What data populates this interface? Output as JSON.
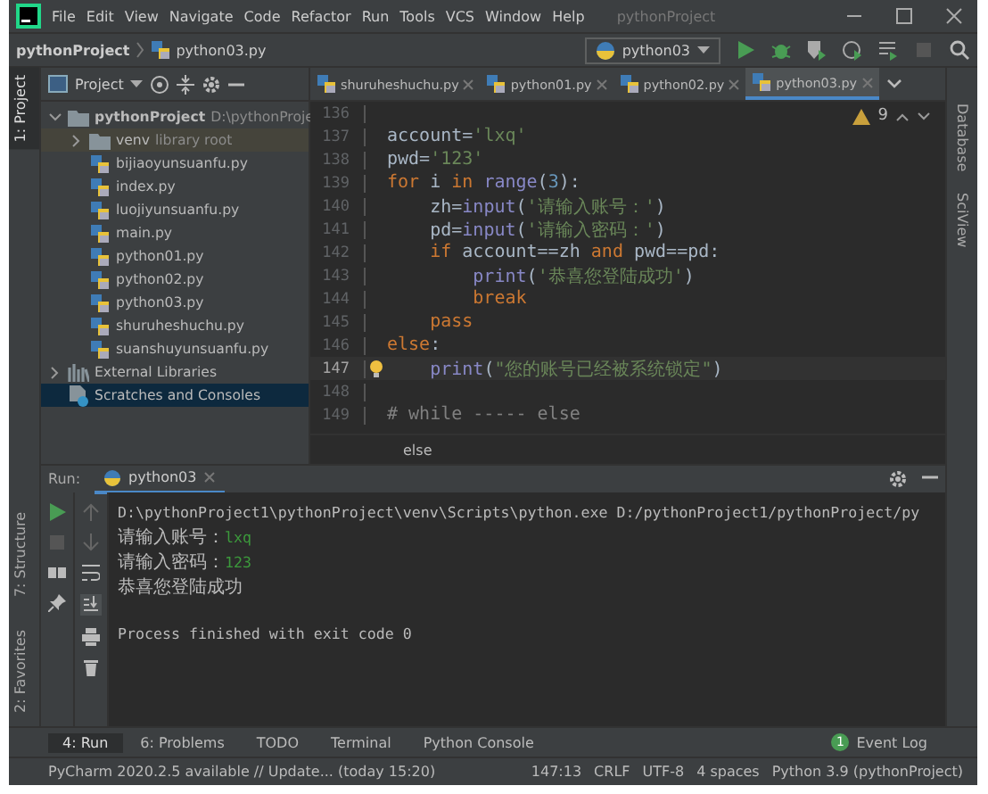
{
  "window": {
    "title": "pythonProject",
    "menu": [
      "File",
      "Edit",
      "View",
      "Navigate",
      "Code",
      "Refactor",
      "Run",
      "Tools",
      "VCS",
      "Window",
      "Help"
    ]
  },
  "navbar": {
    "breadcrumb": [
      "pythonProject",
      "python03.py"
    ],
    "run_config": "python03"
  },
  "left_stripe": {
    "top": [
      {
        "label": "1: Project",
        "selected": true
      }
    ],
    "bottom": [
      {
        "label": "7: Structure",
        "selected": false
      },
      {
        "label": "2: Favorites",
        "selected": false
      }
    ]
  },
  "right_stripe": [
    "Database",
    "SciView"
  ],
  "project_panel": {
    "title": "Project",
    "tree": [
      {
        "label": "pythonProject",
        "hint": "D:\\pythonProje",
        "kind": "folder",
        "expanded": true,
        "selected": false,
        "children": [
          {
            "label": "venv",
            "hint": "library root",
            "kind": "folder",
            "expanded": false,
            "selected": false
          },
          {
            "label": "bijiaoyunsuanfu.py",
            "kind": "file",
            "selected": false
          },
          {
            "label": "index.py",
            "kind": "file",
            "selected": false
          },
          {
            "label": "luojiyunsuanfu.py",
            "kind": "file",
            "selected": false
          },
          {
            "label": "main.py",
            "kind": "file",
            "selected": false
          },
          {
            "label": "python01.py",
            "kind": "file",
            "selected": false
          },
          {
            "label": "python02.py",
            "kind": "file",
            "selected": false
          },
          {
            "label": "python03.py",
            "kind": "file",
            "selected": false
          },
          {
            "label": "shuruheshuchu.py",
            "kind": "file",
            "selected": false
          },
          {
            "label": "suanshuyunsuanfu.py",
            "kind": "file",
            "selected": false
          }
        ]
      },
      {
        "label": "External Libraries",
        "kind": "libraries",
        "expanded": false,
        "selected": false
      },
      {
        "label": "Scratches and Consoles",
        "kind": "scratches",
        "selected": true
      }
    ]
  },
  "editor": {
    "tabs": [
      {
        "label": "shuruheshuchu.py",
        "selected": false
      },
      {
        "label": "python01.py",
        "selected": false
      },
      {
        "label": "python02.py",
        "selected": false
      },
      {
        "label": "python03.py",
        "selected": true
      }
    ],
    "warnings": "9",
    "lines": [
      {
        "number": "136",
        "current": false
      },
      {
        "number": "137",
        "current": false,
        "tokens": [
          {
            "kind": "plain",
            "text": "account="
          },
          {
            "kind": "string",
            "text": "'lxq'"
          }
        ]
      },
      {
        "number": "138",
        "current": false,
        "tokens": [
          {
            "kind": "plain",
            "text": "pwd="
          },
          {
            "kind": "string",
            "text": "'123'"
          }
        ]
      },
      {
        "number": "139",
        "current": false,
        "tokens": [
          {
            "kind": "keyword",
            "text": "for"
          },
          {
            "kind": "plain",
            "text": " i "
          },
          {
            "kind": "keyword",
            "text": "in"
          },
          {
            "kind": "builtin",
            "text": " range"
          },
          {
            "kind": "plain",
            "text": "("
          },
          {
            "kind": "number",
            "text": "3"
          },
          {
            "kind": "plain",
            "text": "):"
          }
        ]
      },
      {
        "number": "140",
        "current": false,
        "tokens": [
          {
            "kind": "plain",
            "text": "    zh="
          },
          {
            "kind": "builtin",
            "text": "input"
          },
          {
            "kind": "plain",
            "text": "("
          },
          {
            "kind": "string",
            "text": "'请输入账号：'"
          },
          {
            "kind": "plain",
            "text": ")"
          }
        ]
      },
      {
        "number": "141",
        "current": false,
        "tokens": [
          {
            "kind": "plain",
            "text": "    pd="
          },
          {
            "kind": "builtin",
            "text": "input"
          },
          {
            "kind": "plain",
            "text": "("
          },
          {
            "kind": "string",
            "text": "'请输入密码：'"
          },
          {
            "kind": "plain",
            "text": ")"
          }
        ]
      },
      {
        "number": "142",
        "current": false,
        "tokens": [
          {
            "kind": "keyword",
            "text": "    if"
          },
          {
            "kind": "plain",
            "text": " account==zh "
          },
          {
            "kind": "keyword",
            "text": "and"
          },
          {
            "kind": "plain",
            "text": " pwd==pd:"
          }
        ]
      },
      {
        "number": "143",
        "current": false,
        "tokens": [
          {
            "kind": "builtin",
            "text": "        print"
          },
          {
            "kind": "plain",
            "text": "("
          },
          {
            "kind": "string",
            "text": "'恭喜您登陆成功'"
          },
          {
            "kind": "plain",
            "text": ")"
          }
        ]
      },
      {
        "number": "144",
        "current": false,
        "tokens": [
          {
            "kind": "keyword",
            "text": "        break"
          }
        ]
      },
      {
        "number": "145",
        "current": false,
        "tokens": [
          {
            "kind": "keyword",
            "text": "    pass"
          }
        ]
      },
      {
        "number": "146",
        "current": false,
        "tokens": [
          {
            "kind": "keyword",
            "text": "else"
          },
          {
            "kind": "plain",
            "text": ":"
          }
        ]
      },
      {
        "number": "147",
        "current": true,
        "intention": true,
        "tokens": [
          {
            "kind": "builtin",
            "text": "    print"
          },
          {
            "kind": "plain",
            "text": "("
          },
          {
            "kind": "string",
            "text": "\"您的账号已经被系统锁定\""
          },
          {
            "kind": "plain",
            "text": ")"
          }
        ]
      },
      {
        "number": "148",
        "current": false
      },
      {
        "number": "149",
        "current": false,
        "tokens": [
          {
            "kind": "comment",
            "text": "# while ----- else"
          }
        ]
      }
    ],
    "breadcrumb": "else"
  },
  "run_panel": {
    "label": "Run:",
    "tab": "python03",
    "output": [
      [
        {
          "kind": "output",
          "text": "D:\\pythonProject1\\pythonProject\\venv\\Scripts\\python.exe D:/pythonProject1/pythonProject/py"
        }
      ],
      [
        {
          "kind": "output",
          "text": "请输入账号："
        },
        {
          "kind": "input",
          "text": "lxq"
        }
      ],
      [
        {
          "kind": "output",
          "text": "请输入密码："
        },
        {
          "kind": "input",
          "text": "123"
        }
      ],
      [
        {
          "kind": "output",
          "text": "恭喜您登陆成功"
        }
      ]
    ],
    "exit_message": "Process finished with exit code 0"
  },
  "tool_tabs": [
    {
      "label": "4: Run",
      "selected": true
    },
    {
      "label": "6: Problems",
      "selected": false
    },
    {
      "label": "TODO",
      "selected": false
    },
    {
      "label": "Terminal",
      "selected": false
    },
    {
      "label": "Python Console",
      "selected": false
    }
  ],
  "event_log": {
    "label": "Event Log",
    "count": "1"
  },
  "status_bar": {
    "message": "PyCharm 2020.2.5 available // Update... (today 15:20)",
    "items": [
      "147:13",
      "CRLF",
      "UTF-8",
      "4 spaces",
      "Python 3.9 (pythonProject)"
    ]
  }
}
